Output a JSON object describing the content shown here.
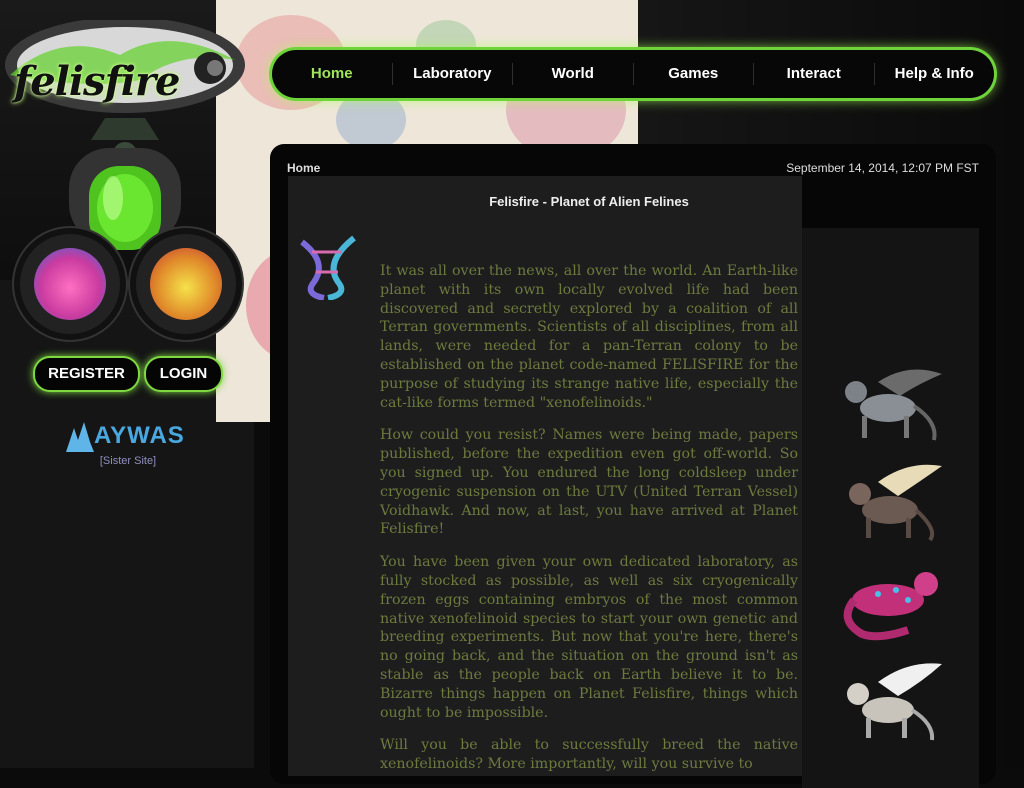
{
  "brand": {
    "logo_text": "felisfire",
    "logo_icon": "felisfire-logo"
  },
  "nav": {
    "items": [
      {
        "label": "Home",
        "active": true
      },
      {
        "label": "Laboratory"
      },
      {
        "label": "World"
      },
      {
        "label": "Games"
      },
      {
        "label": "Interact"
      },
      {
        "label": "Help & Info"
      }
    ]
  },
  "auth": {
    "register_label": "REGISTER",
    "login_label": "LOGIN"
  },
  "sister": {
    "logo_text": "AYWAS",
    "caption": "[Sister Site]"
  },
  "header": {
    "breadcrumb": "Home",
    "datetime": "September 14, 2014, 12:07 PM FST"
  },
  "page": {
    "title": "Felisfire - Planet of Alien Felines",
    "paragraphs": [
      "It was all over the news, all over the world. An Earth-like planet with its own locally evolved life had been discovered and secretly explored by a coalition of all Terran governments. Scientists of all disciplines, from all lands, were needed for a pan-Terran colony to be established on the planet code-named FELISFIRE for the purpose of studying its strange native life, especially the cat-like forms termed \"xenofelinoids.\"",
      "How could you resist? Names were being made, papers published, before the expedition even got off-world. So you signed up. You endured the long coldsleep under cryogenic suspension on the UTV (United Terran Vessel) Voidhawk. And now, at last, you have arrived at Planet Felisfire!",
      "You have been given your own dedicated laboratory, as fully stocked as possible, as well as six cryogenically frozen eggs containing embryos of the most common native xenofelinoid species to start your own genetic and breeding experiments. But now that you're here, there's no going back, and the situation on the ground isn't as stable as the people back on Earth believe it to be. Bizarre things happen on Planet Felisfire, things which ought to be impossible.",
      "Will you be able to successfully breed the native xenofelinoids? More importantly, will you survive to"
    ]
  },
  "colors": {
    "accent": "#7ed840",
    "active_nav": "#9fe55a",
    "story_text": "#6d7a3e"
  }
}
